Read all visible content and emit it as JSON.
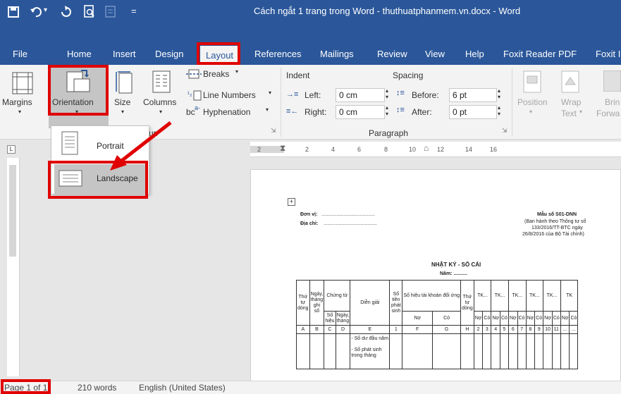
{
  "title_bar": {
    "title": "Cách ngắt 1 trang trong Word - thuthuatphanmem.vn.docx  -  Word",
    "customize_glyph": "="
  },
  "tabs": [
    "File",
    "Home",
    "Insert",
    "Design",
    "Layout",
    "References",
    "Mailings",
    "Review",
    "View",
    "Help",
    "Foxit Reader PDF",
    "Foxit I"
  ],
  "active_tab": "Layout",
  "page_setup": {
    "margins": "Margins",
    "orientation": "Orientation",
    "size": "Size",
    "columns": "Columns",
    "breaks": "Breaks",
    "line_numbers": "Line Numbers",
    "hyphenation": "Hyphenation",
    "group_label_partial": "up"
  },
  "paragraph": {
    "indent_label": "Indent",
    "spacing_label": "Spacing",
    "left_label": "Left:",
    "left_value": "0 cm",
    "right_label": "Right:",
    "right_value": "0 cm",
    "before_label": "Before:",
    "before_value": "6 pt",
    "after_label": "After:",
    "after_value": "0 pt",
    "group_label": "Paragraph"
  },
  "arrange": {
    "position": "Position",
    "wrap_text_1": "Wrap",
    "wrap_text_2": "Text",
    "bring_forward_1": "Brin",
    "bring_forward_2": "Forwa"
  },
  "orientation_menu": {
    "portrait": "Portrait",
    "landscape": "Landscape",
    "highlighted": "Landscape"
  },
  "ruler": {
    "ticks": [
      "2",
      "2",
      "4",
      "6",
      "8",
      "10",
      "12",
      "14",
      "16"
    ]
  },
  "document": {
    "unit_label": "Đơn vị:",
    "address_label": "Địa chỉ:",
    "form_code": "Mẫu số S01-DNN",
    "form_note_1": "(Ban hành theo Thông tư số",
    "form_note_2": "133/2016/TT-BTC ngày",
    "form_note_3": "26/8/2016 của Bộ Tài chính)",
    "heading": "NHẬT KÝ - SỔ CÁI",
    "year": "Năm: ..........",
    "rows": [
      "- Số dư đầu năm",
      "- Số phát sinh trong tháng"
    ]
  },
  "status_bar": {
    "page": "Page 1 of 1",
    "words": "210 words",
    "language": "English (United States)"
  },
  "colors": {
    "title_blue": "#2b579a",
    "highlight_red": "#e00000"
  }
}
